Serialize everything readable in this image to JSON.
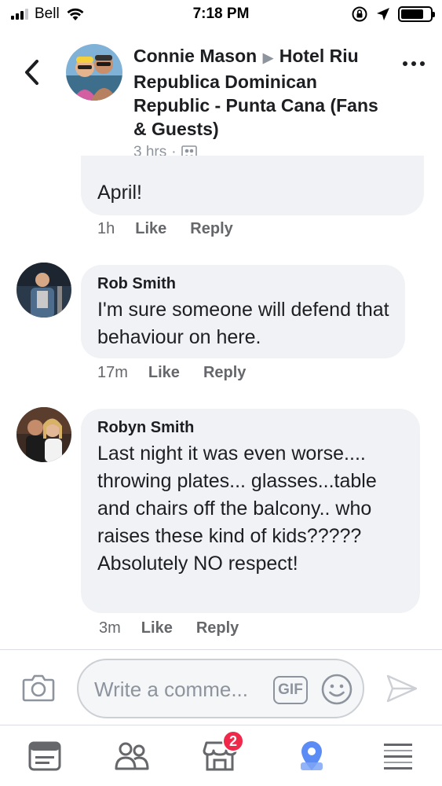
{
  "status_bar": {
    "carrier": "Bell",
    "time": "7:18 PM"
  },
  "header": {
    "author": "Connie Mason",
    "group": "Hotel Riu Republica Dominican Republic - Punta Cana (Fans & Guests)",
    "time_ago": "3 hrs",
    "separator": "·",
    "audience_icon": "group-audience-icon"
  },
  "comments": [
    {
      "author": "",
      "text": "April!",
      "time": "1h",
      "like_label": "Like",
      "reply_label": "Reply"
    },
    {
      "author": "Rob Smith",
      "text": "I'm sure someone will defend that behaviour on here.",
      "time": "17m",
      "like_label": "Like",
      "reply_label": "Reply"
    },
    {
      "author": "Robyn Smith",
      "text": "Last night it was even worse.... throwing plates... glasses...table and chairs off the balcony.. who raises these kind of kids????? Absolutely NO respect!",
      "time": "3m",
      "like_label": "Like",
      "reply_label": "Reply"
    }
  ],
  "composer": {
    "placeholder": "Write a comme...",
    "gif_label": "GIF"
  },
  "tab_bar": {
    "marketplace_badge": "2",
    "tabs": [
      "news-feed-icon",
      "groups-icon",
      "marketplace-icon",
      "maps-icon",
      "menu-icon"
    ]
  },
  "colors": {
    "bubble": "#f0f2f5",
    "secondary_text": "#65676b",
    "icon_gray": "#8d949e",
    "badge_red": "#f02849",
    "facebook_blue": "#1877f2"
  }
}
